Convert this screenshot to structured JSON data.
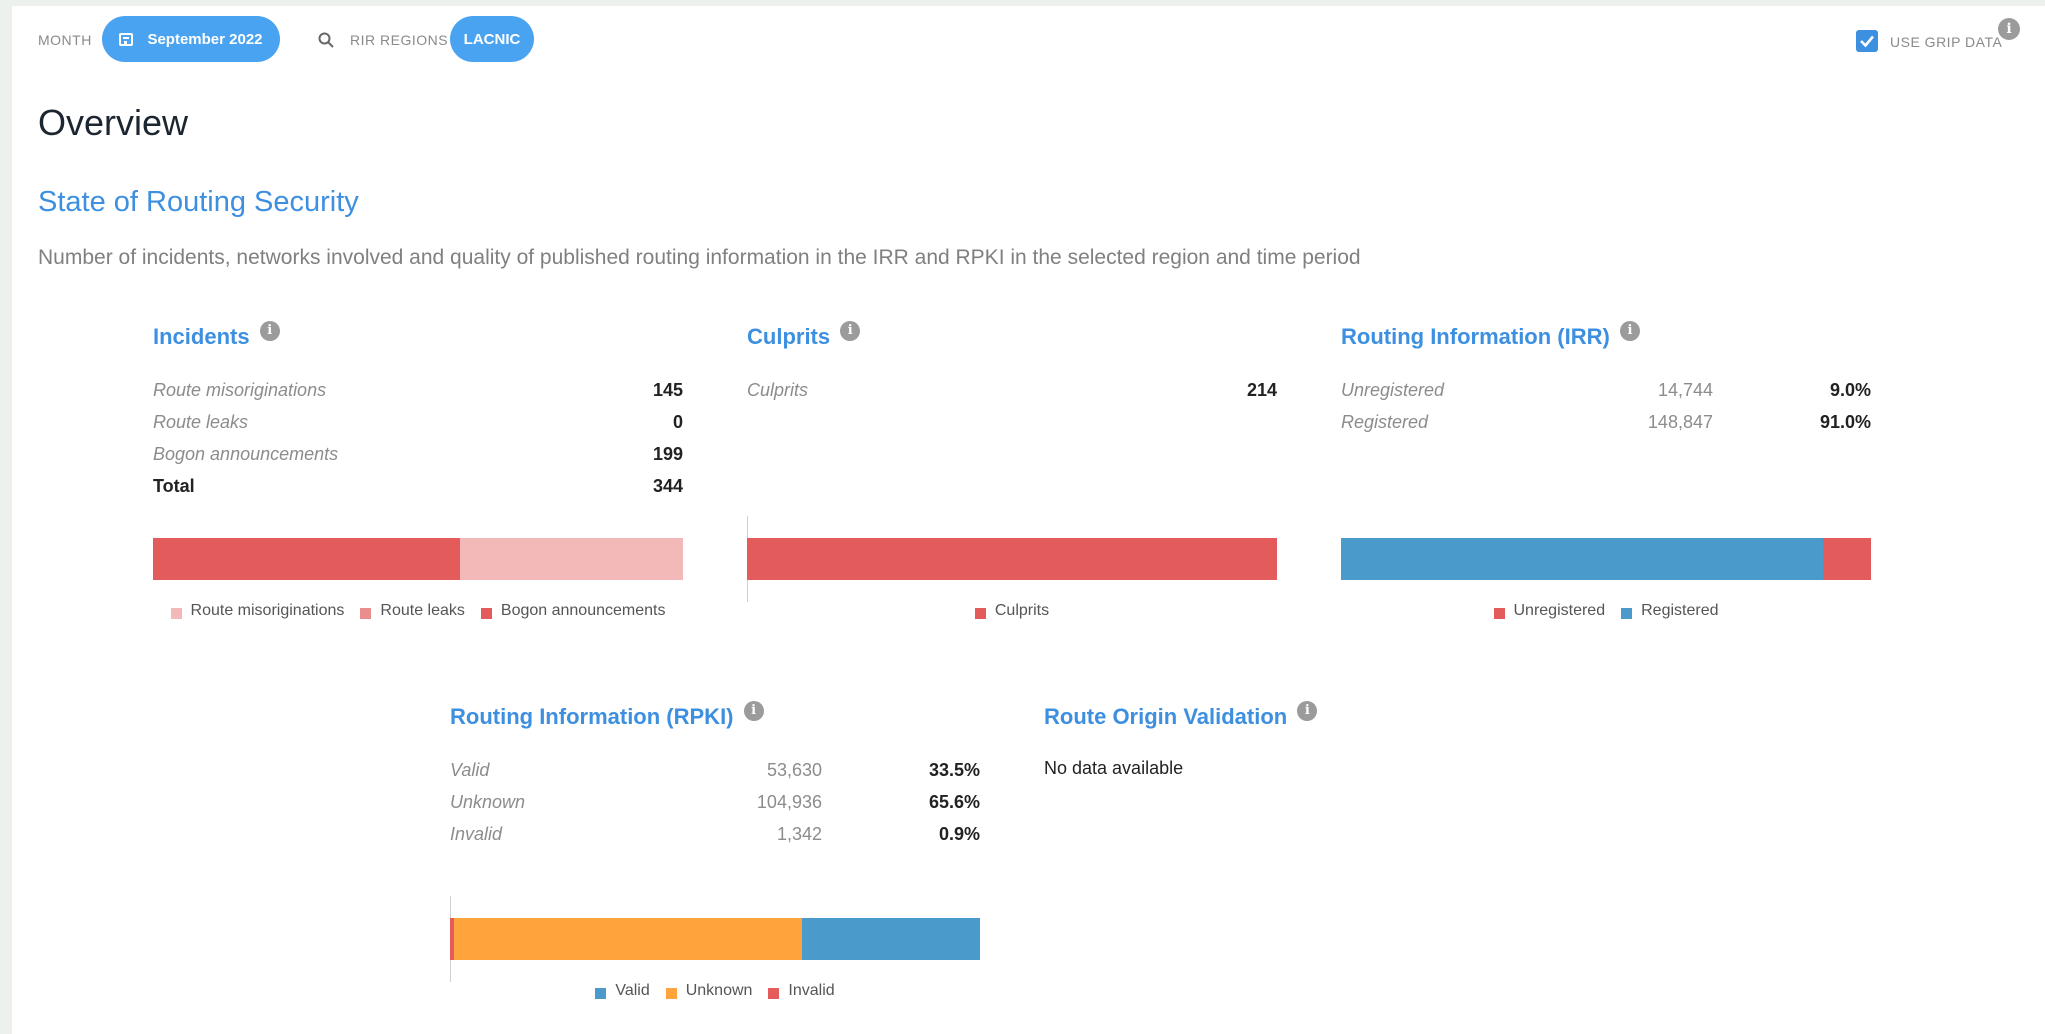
{
  "filters": {
    "month_label": "MONTH",
    "month_value": "September 2022",
    "rir_label": "RIR REGIONS",
    "rir_value": "LACNIC",
    "grip_label": "USE GRIP DATA",
    "grip_checked": true
  },
  "page_title": "Overview",
  "section": {
    "title": "State of Routing Security",
    "description": "Number of incidents, networks involved and quality of published routing information in the IRR and RPKI in the selected region and time period"
  },
  "colors": {
    "accent": "#4aa3f0",
    "red": "#e35b5b",
    "light_red": "#f3b9b9",
    "mid_red": "#ea8d8d",
    "blue": "#4a9bcc",
    "orange": "#ffa33d"
  },
  "incidents": {
    "title": "Incidents",
    "rows": [
      {
        "name": "Route misoriginations",
        "value": "145"
      },
      {
        "name": "Route leaks",
        "value": "0"
      },
      {
        "name": "Bogon announcements",
        "value": "199"
      }
    ],
    "total_label": "Total",
    "total_value": "344",
    "bar": [
      {
        "key": "bogon",
        "value": 199,
        "color": "#e35b5b"
      },
      {
        "key": "leaks",
        "value": 0,
        "color": "#ea8d8d"
      },
      {
        "key": "misorig",
        "value": 145,
        "color": "#f3b9b9"
      }
    ],
    "legend": [
      {
        "label": "Route misoriginations",
        "color": "#f3b9b9"
      },
      {
        "label": "Route leaks",
        "color": "#ea8d8d"
      },
      {
        "label": "Bogon announcements",
        "color": "#e35b5b"
      }
    ]
  },
  "culprits": {
    "title": "Culprits",
    "rows": [
      {
        "name": "Culprits",
        "value": "214"
      }
    ],
    "bar": [
      {
        "key": "culprits",
        "value": 214,
        "color": "#e35b5b"
      }
    ],
    "legend": [
      {
        "label": "Culprits",
        "color": "#e35b5b"
      }
    ]
  },
  "irr": {
    "title": "Routing Information (IRR)",
    "rows": [
      {
        "name": "Unregistered",
        "count": "14,744",
        "pct": "9.0%"
      },
      {
        "name": "Registered",
        "count": "148,847",
        "pct": "91.0%"
      }
    ],
    "bar": [
      {
        "key": "registered",
        "value": 148847,
        "color": "#4a9bcc"
      },
      {
        "key": "unregistered",
        "value": 14744,
        "color": "#e35b5b"
      }
    ],
    "legend": [
      {
        "label": "Unregistered",
        "color": "#e35b5b"
      },
      {
        "label": "Registered",
        "color": "#4a9bcc"
      }
    ]
  },
  "rpki": {
    "title": "Routing Information (RPKI)",
    "rows": [
      {
        "name": "Valid",
        "count": "53,630",
        "pct": "33.5%"
      },
      {
        "name": "Unknown",
        "count": "104,936",
        "pct": "65.6%"
      },
      {
        "name": "Invalid",
        "count": "1,342",
        "pct": "0.9%"
      }
    ],
    "bar": [
      {
        "key": "invalid",
        "value": 1342,
        "color": "#e35b5b"
      },
      {
        "key": "unknown",
        "value": 104936,
        "color": "#ffa33d"
      },
      {
        "key": "valid",
        "value": 53630,
        "color": "#4a9bcc"
      }
    ],
    "legend": [
      {
        "label": "Valid",
        "color": "#4a9bcc"
      },
      {
        "label": "Unknown",
        "color": "#ffa33d"
      },
      {
        "label": "Invalid",
        "color": "#e35b5b"
      }
    ]
  },
  "rov": {
    "title": "Route Origin Validation",
    "message": "No data available"
  },
  "icons": {
    "info": "i"
  }
}
